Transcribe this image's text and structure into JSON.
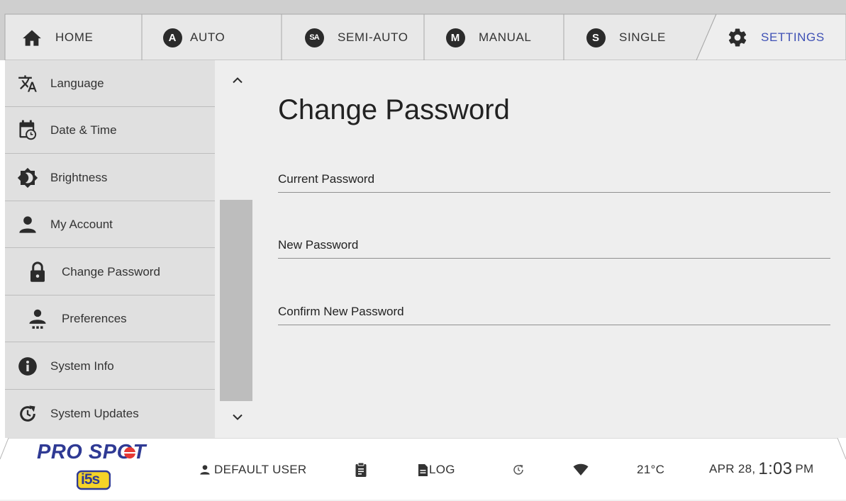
{
  "tabs": [
    {
      "label": "HOME",
      "icon": "home-icon"
    },
    {
      "label": "AUTO",
      "icon": "auto-badge-icon",
      "badge": "A"
    },
    {
      "label": "SEMI-AUTO",
      "icon": "semi-auto-badge-icon",
      "badge": "SA"
    },
    {
      "label": "MANUAL",
      "icon": "manual-badge-icon",
      "badge": "M"
    },
    {
      "label": "SINGLE",
      "icon": "single-badge-icon",
      "badge": "S"
    },
    {
      "label": "SETTINGS",
      "icon": "gear-icon",
      "active": true
    }
  ],
  "sidebar": {
    "items": [
      {
        "label": "Language",
        "icon": "translate-icon"
      },
      {
        "label": "Date & Time",
        "icon": "calendar-clock-icon"
      },
      {
        "label": "Brightness",
        "icon": "brightness-icon"
      },
      {
        "label": "My Account",
        "icon": "person-icon"
      },
      {
        "label": "Change Password",
        "icon": "lock-icon",
        "selected": true
      },
      {
        "label": "Preferences",
        "icon": "person-settings-icon"
      },
      {
        "label": "System Info",
        "icon": "info-icon"
      },
      {
        "label": "System Updates",
        "icon": "update-icon"
      }
    ]
  },
  "main": {
    "title": "Change Password",
    "fields": [
      {
        "placeholder": "Current Password",
        "value": ""
      },
      {
        "placeholder": "New Password",
        "value": ""
      },
      {
        "placeholder": "Confirm New Password",
        "value": ""
      }
    ]
  },
  "statusbar": {
    "logo_text": "PRO SPOT",
    "logo_badge": "i5s",
    "user": "DEFAULT USER",
    "log_label": "LOG",
    "temperature": "21°C",
    "date": "APR 28,",
    "time": "1:03",
    "ampm": "PM"
  },
  "colors": {
    "accent": "#3f51b5",
    "tabbar_bg": "#cfcfcf",
    "tab_bg": "#e8e8e8",
    "sidebar_bg": "#e0e0e0",
    "content_bg": "#eeeeee",
    "logo_blue": "#2f3a94",
    "logo_red": "#e53935",
    "badge_yellow": "#f5d327"
  }
}
